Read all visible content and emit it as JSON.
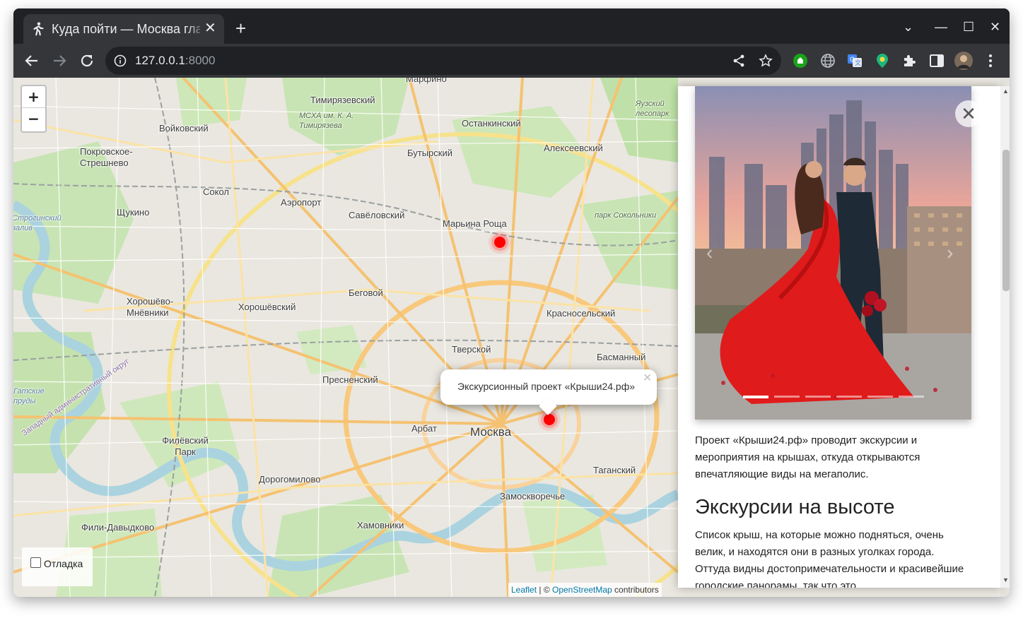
{
  "browser": {
    "tab_title": "Куда пойти — Москва глазами Артёма",
    "tab_close": "✕",
    "new_tab": "+",
    "window_controls": {
      "tabs_menu": "⌄",
      "minimize": "—",
      "maximize": "☐",
      "close": "✕"
    },
    "url_host": "127.0.0.1",
    "url_port": ":8000",
    "icons": [
      "back-icon",
      "forward-icon",
      "reload-icon",
      "info-icon",
      "share-icon",
      "star-icon",
      "extension-green-icon",
      "globe-icon",
      "translate-icon",
      "extension-map-icon",
      "puzzle-icon",
      "sidepanel-icon",
      "avatar",
      "more-icon"
    ]
  },
  "map": {
    "zoom_in": "+",
    "zoom_out": "−",
    "labels": [
      {
        "text": "Марфино"
      },
      {
        "text": "Тимирязевский"
      },
      {
        "text": "МСХА им. К. А. Тимирязева"
      },
      {
        "text": "Останкинский"
      },
      {
        "text": "Яузский лесопарк"
      },
      {
        "text": "Войковский"
      },
      {
        "text": "Бутырский"
      },
      {
        "text": "Алексеевский"
      },
      {
        "text": "Покровское-Стрешнево"
      },
      {
        "text": "Сокол"
      },
      {
        "text": "Аэропорт"
      },
      {
        "text": "Савёловский"
      },
      {
        "text": "Щукино"
      },
      {
        "text": "Марьина Роща"
      },
      {
        "text": "парк Сокольники"
      },
      {
        "text": "Строгинский залив"
      },
      {
        "text": "Беговой"
      },
      {
        "text": "Хорошёво-Мнёвники"
      },
      {
        "text": "Хорошёвский"
      },
      {
        "text": "Красносельский"
      },
      {
        "text": "Тверской"
      },
      {
        "text": "Басманный"
      },
      {
        "text": "Пресненский"
      },
      {
        "text": "Москва"
      },
      {
        "text": "Арбат"
      },
      {
        "text": "Филёвский Парк"
      },
      {
        "text": "Таганский"
      },
      {
        "text": "Дорогомилово"
      },
      {
        "text": "Замоскворечье"
      },
      {
        "text": "Хамовники"
      },
      {
        "text": "Фили-Давыдково"
      },
      {
        "text": "Западный административный округ"
      },
      {
        "text": "Гатские пруды"
      }
    ],
    "debug_label": "Отладка",
    "attribution": {
      "leaflet": "Leaflet",
      "sep": " | © ",
      "osm": "OpenStreetMap",
      "tail": " contributors"
    },
    "popup": {
      "text": "Экскурсионный проект «Крыши24.рф»",
      "close": "✕"
    }
  },
  "panel": {
    "close": "✕",
    "carousel_slides": 6,
    "carousel_active": 1,
    "description": "Проект «Крыши24.рф» проводит экскурсии и мероприятия на крышах, откуда открываются впечатляющие виды на мегаполис.",
    "heading": "Экскурсии на высоте",
    "body": "Список крыш, на которые можно подняться, очень велик, и находятся они в разных уголках города. Оттуда видны достопримечательности и красивейшие городские панорамы, так что это"
  },
  "colors": {
    "chrome_dark": "#202124",
    "chrome_tab": "#35363a",
    "marker": "#ff0000",
    "link": "#0078a8"
  }
}
